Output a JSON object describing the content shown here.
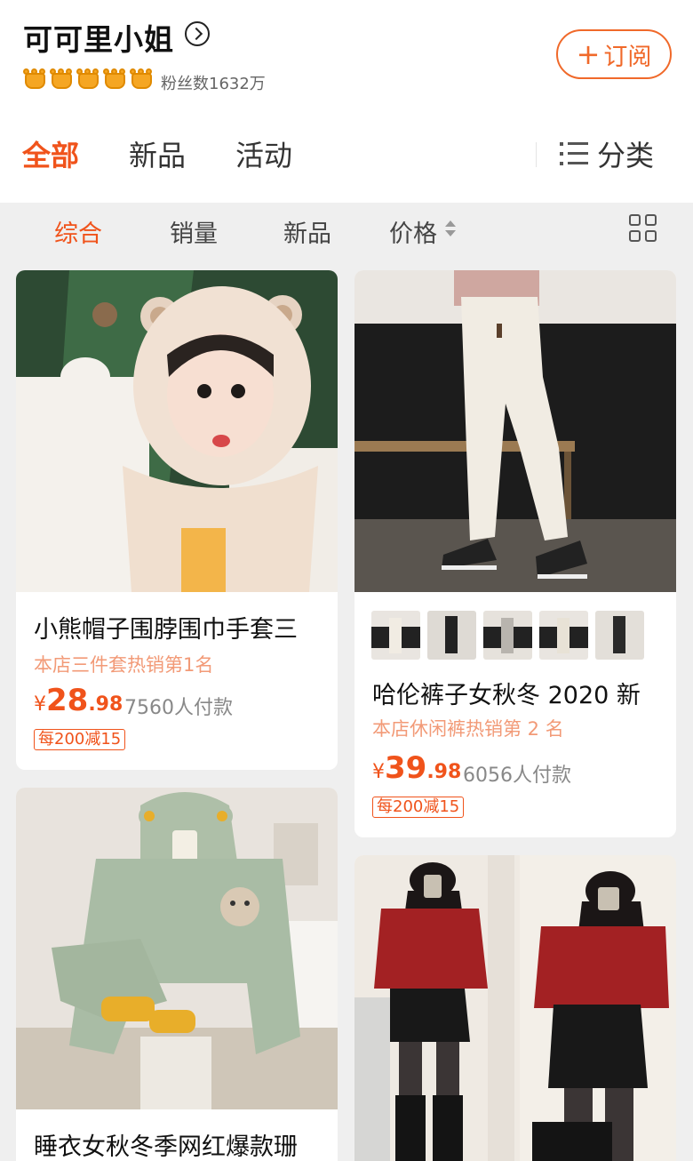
{
  "shop": {
    "name": "可可里小姐",
    "fans": "粉丝数1632万",
    "subscribe_label": "订阅",
    "subscribe_plus": "+"
  },
  "main_tabs": [
    {
      "label": "全部",
      "active": true
    },
    {
      "label": "新品",
      "active": false
    },
    {
      "label": "活动",
      "active": false
    }
  ],
  "category_label": "分类",
  "sort_bar": [
    {
      "label": "综合",
      "active": true
    },
    {
      "label": "销量",
      "active": false
    },
    {
      "label": "新品",
      "active": false
    },
    {
      "label": "价格",
      "active": false
    }
  ],
  "products": [
    {
      "title": "小熊帽子围脖围巾手套三",
      "rank": "本店三件套热销第1名",
      "currency": "¥",
      "price_int": "28",
      "price_dec": ".98",
      "sales": "7560人付款",
      "coupon": "每200减15"
    },
    {
      "title": "哈伦裤子女秋冬 2020 新",
      "rank": "本店休闲裤热销第 2 名",
      "currency": "¥",
      "price_int": "39",
      "price_dec": ".98",
      "sales": "6056人付款",
      "coupon": "每200减15"
    },
    {
      "title": "睡衣女秋冬季网红爆款珊"
    },
    {
      "title": ""
    }
  ],
  "colors": {
    "accent": "#f0531b",
    "rank_text": "#f29a77",
    "background": "#efefef",
    "crown": "#f5a623"
  }
}
